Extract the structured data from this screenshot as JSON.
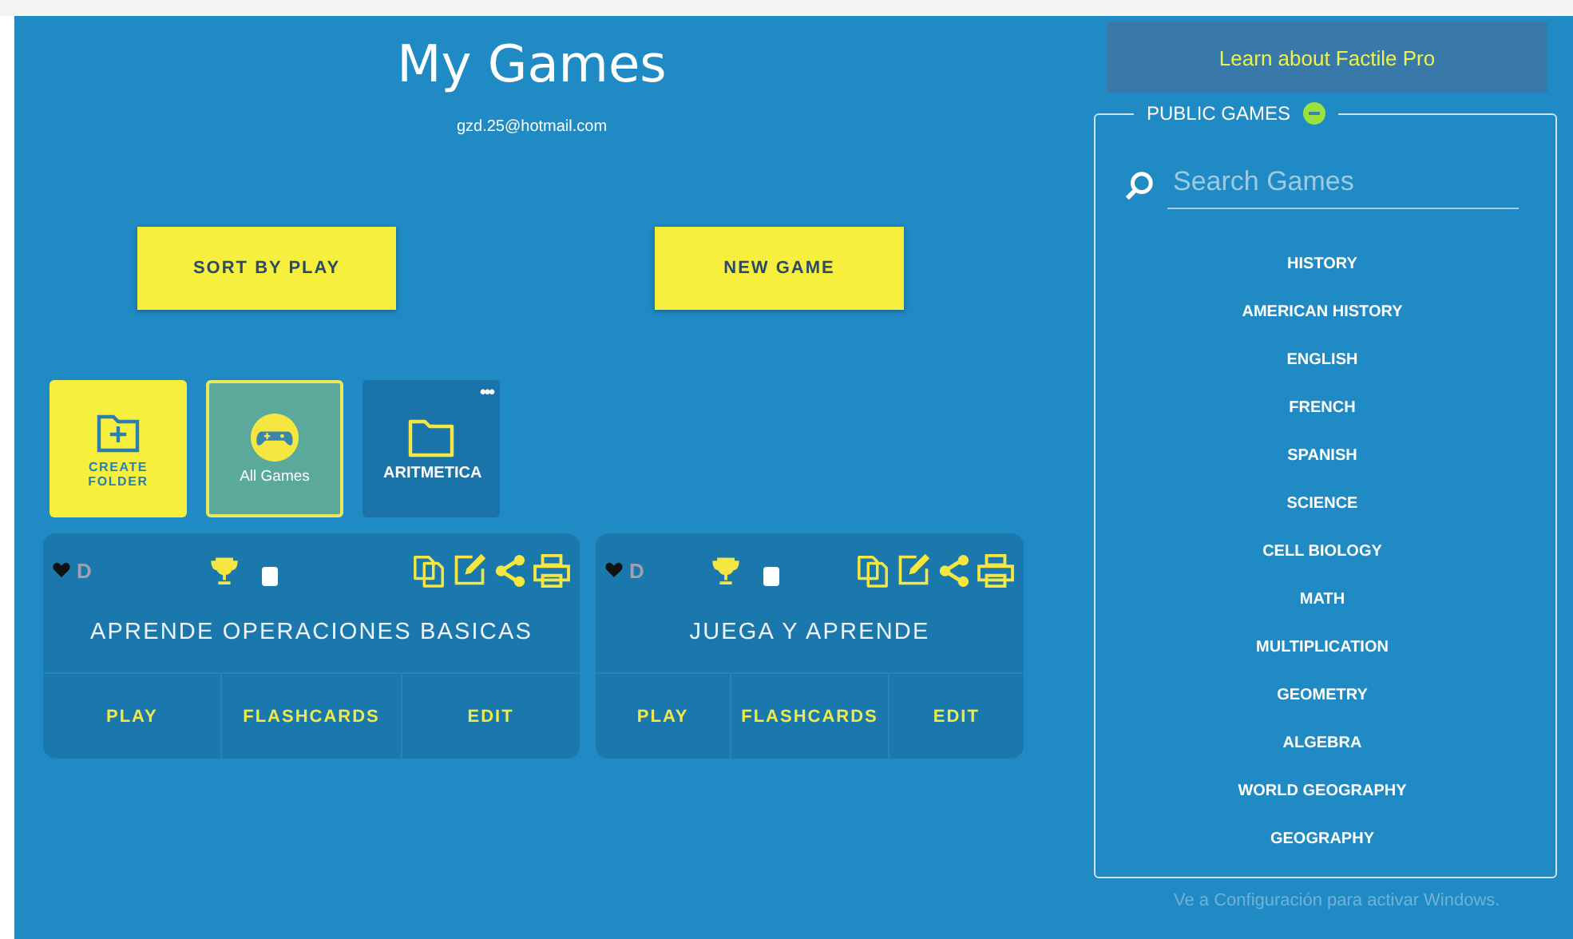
{
  "header": {
    "title": "My Games",
    "email": "gzd.25@hotmail.com"
  },
  "actions": [
    "SORT BY PLAY",
    "NEW GAME"
  ],
  "folders": [
    {
      "kind": "create",
      "label": "CREATE FOLDER",
      "selected": false
    },
    {
      "kind": "all",
      "label": "All Games",
      "selected": true
    },
    {
      "kind": "folder",
      "label": "ARITMETICA",
      "selected": false,
      "menu": "•••"
    }
  ],
  "games": [
    {
      "favorite_mark": "D",
      "title": "APRENDE OPERACIONES BASICAS",
      "buttons": [
        "PLAY",
        "FLASHCARDS",
        "EDIT"
      ]
    },
    {
      "favorite_mark": "D",
      "title": "JUEGA Y APRENDE",
      "buttons": [
        "PLAY",
        "FLASHCARDS",
        "EDIT"
      ]
    }
  ],
  "promo": {
    "label": "Learn about Factile Pro"
  },
  "public_games": {
    "title": "PUBLIC GAMES",
    "expanded": true,
    "search": {
      "placeholder": "Search Games"
    },
    "categories": [
      "HISTORY",
      "AMERICAN HISTORY",
      "ENGLISH",
      "FRENCH",
      "SPANISH",
      "SCIENCE",
      "CELL BIOLOGY",
      "MATH",
      "MULTIPLICATION",
      "GEOMETRY",
      "ALGEBRA",
      "WORLD GEOGRAPHY",
      "GEOGRAPHY"
    ]
  },
  "os_notice": "Ve a Configuración para activar Windows."
}
